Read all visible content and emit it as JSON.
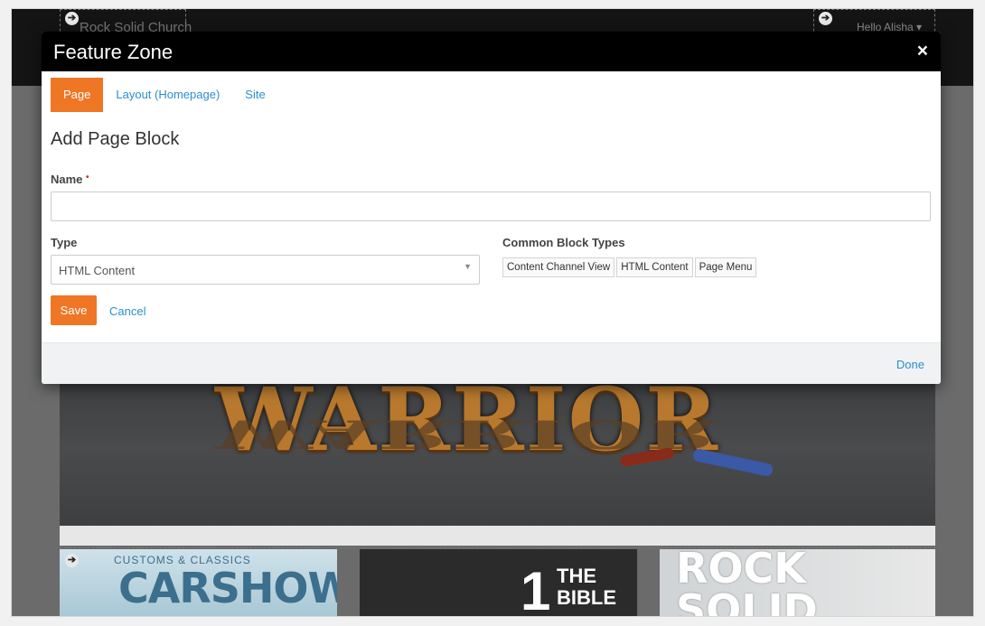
{
  "background": {
    "site_title": "Rock Solid Church",
    "greeting": "Hello Alisha",
    "hero_text": "WARRIOR",
    "tiles": [
      {
        "small": "CUSTOMS & CLASSICS",
        "big": "CARSHOW"
      },
      {
        "number": "1",
        "words": "THE\nBIBLE"
      },
      {
        "words": "ROCK\nSOLID"
      }
    ]
  },
  "modal": {
    "title": "Feature Zone",
    "close_icon": "×",
    "tabs": [
      {
        "label": "Page",
        "active": true
      },
      {
        "label": "Layout (Homepage)",
        "active": false
      },
      {
        "label": "Site",
        "active": false
      }
    ],
    "heading": "Add Page Block",
    "name_label": "Name",
    "name_required_mark": "•",
    "name_value": "",
    "type_label": "Type",
    "type_value": "HTML Content",
    "common_label": "Common Block Types",
    "common_types": [
      "Content Channel View",
      "HTML Content",
      "Page Menu"
    ],
    "save_label": "Save",
    "cancel_label": "Cancel",
    "done_label": "Done"
  },
  "colors": {
    "accent": "#ee7625",
    "link": "#2b8fcc",
    "header": "#000000"
  }
}
